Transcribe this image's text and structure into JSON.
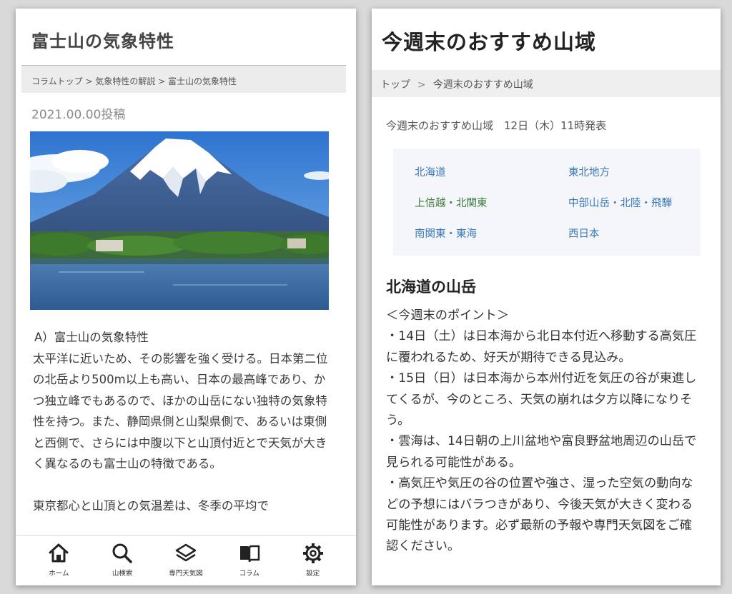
{
  "left": {
    "title": "富士山の気象特性",
    "breadcrumb": "コラムトップ > 気象特性の解説 > 富士山の気象特性",
    "post_date": "2021.00.00投稿",
    "article": {
      "heading": "A）富士山の気象特性",
      "para1": "太平洋に近いため、その影響を強く受ける。日本第二位の北岳より500m以上も高い、日本の最高峰であり、かつ独立峰でもあるので、ほかの山岳にない独特の気象特性を持つ。また、静岡県側と山梨県側で、あるいは東側と西側で、さらには中腹以下と山頂付近とで天気が大きく異なるのも富士山の特徴である。",
      "para2": "東京都心と山頂との気温差は、冬季の平均で"
    },
    "nav": [
      {
        "label": "ホーム",
        "icon": "home-icon"
      },
      {
        "label": "山検索",
        "icon": "search-icon"
      },
      {
        "label": "専門天気図",
        "icon": "layers-icon"
      },
      {
        "label": "コラム",
        "icon": "book-icon"
      },
      {
        "label": "設定",
        "icon": "gear-icon"
      }
    ]
  },
  "right": {
    "title": "今週末のおすすめ山域",
    "breadcrumb": {
      "home": "トップ",
      "separator": ">",
      "current": "今週末のおすすめ山域"
    },
    "announce": "今週末のおすすめ山域　12日（木）11時発表",
    "regions": [
      {
        "label": "北海道"
      },
      {
        "label": "東北地方"
      },
      {
        "label": "上信越・北関東"
      },
      {
        "label": "中部山岳・北陸・飛騨"
      },
      {
        "label": "南関東・東海"
      },
      {
        "label": "西日本"
      }
    ],
    "section_title": "北海道の山岳",
    "points_heading": "＜今週末のポイント＞",
    "points": [
      "・14日（土）は日本海から北日本付近へ移動する高気圧に覆われるため、好天が期待できる見込み。",
      "・15日（日）は日本海から本州付近を気圧の谷が東進してくるが、今のところ、天気の崩れは夕方以降になりそう。",
      "・雲海は、14日朝の上川盆地や富良野盆地周辺の山岳で見られる可能性がある。",
      "・高気圧や気圧の谷の位置や強さ、湿った空気の動向などの予想にはバラつきがあり、今後天気が大きく変わる可能性があります。必ず最新の予報や専門天気図をご確認ください。"
    ]
  },
  "colors": {
    "link": "#3b79b8",
    "active_link": "#3b7a3b",
    "region_box_bg": "#f4f6fa",
    "breadcrumb_bg": "#ececec"
  }
}
